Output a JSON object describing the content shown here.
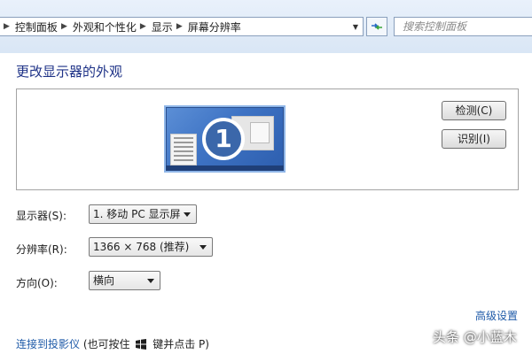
{
  "breadcrumb": {
    "items": [
      "控制面板",
      "外观和个性化",
      "显示",
      "屏幕分辨率"
    ]
  },
  "search": {
    "placeholder": "搜索控制面板"
  },
  "page_title": "更改显示器的外观",
  "preview": {
    "monitor_number": "1"
  },
  "buttons": {
    "detect": "检测(C)",
    "identify": "识别(I)"
  },
  "settings": {
    "display_label": "显示器(S):",
    "display_value": "1. 移动 PC 显示屏",
    "resolution_label": "分辨率(R):",
    "resolution_value": "1366 × 768 (推荐)",
    "orientation_label": "方向(O):",
    "orientation_value": "横向"
  },
  "advanced_link": "高级设置",
  "projector": {
    "link": "连接到投影仪",
    "hint_prefix": "(也可按住",
    "hint_suffix": "键并点击 P)"
  },
  "watermark": "头条 @小蓝木",
  "colors": {
    "link": "#1e5aa8",
    "title": "#1e3287",
    "monitor": "#3e73c4"
  }
}
